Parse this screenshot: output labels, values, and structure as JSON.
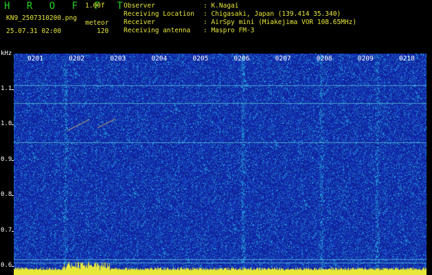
{
  "header": {
    "app_title": "H R O F F T",
    "version": "1.00f",
    "filename": "KN9_2507310200.png",
    "datetime": "25.07.31 02:00",
    "meteor_label": "meteor",
    "meteor_count": "120",
    "info_labels": [
      "Observer",
      "Receiving Location",
      "Receiver",
      "Receiving antenna"
    ],
    "info_values": [
      ": K.Nagai",
      ": Chigasaki, Japan (139.414 35.340)",
      ": AirSpy mini (Miakejima VOR 108.65MHz)",
      ": Maspro FM-3"
    ]
  },
  "chart_data": {
    "type": "heatmap",
    "ylabel": "kHz",
    "y_ticks": [
      "1.1",
      "1.0",
      "0.9",
      "0.8",
      "0.7",
      "0.6"
    ],
    "y_tick_values": [
      1.1,
      1.0,
      0.9,
      0.8,
      0.7,
      0.6
    ],
    "ylim": [
      0.575,
      1.2
    ],
    "x_ticks": [
      "0201",
      "0202",
      "0203",
      "0204",
      "0205",
      "0206",
      "0207",
      "0208",
      "0209",
      "0210"
    ],
    "xlim": [
      0,
      10
    ],
    "background_color": "#1a2fb8",
    "signal_lines_khz": [
      1.11,
      1.06,
      0.95,
      0.62,
      0.61
    ],
    "vertical_bursts_min": [
      1.25,
      5.55,
      7.45,
      8.8
    ]
  }
}
